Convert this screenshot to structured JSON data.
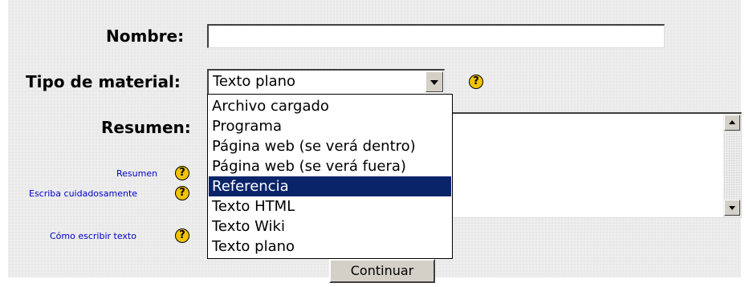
{
  "form": {
    "name_label": "Nombre:",
    "name_value": "",
    "type_label": "Tipo de material:",
    "type_selected": "Texto plano",
    "summary_label": "Resumen:",
    "help_icon_char": "?",
    "continue_label": "Continuar",
    "help_links": [
      "Resumen",
      "Escriba cuidadosamente",
      "Cómo escribir texto"
    ]
  },
  "dropdown": {
    "options": [
      "Archivo cargado",
      "Programa",
      "Página web (se verá dentro)",
      "Página web (se verá fuera)",
      "Referencia",
      "Texto HTML",
      "Texto Wiki",
      "Texto plano"
    ],
    "highlighted_index": 4
  },
  "colors": {
    "highlight": "#0a246a",
    "help_icon": "#f2c300",
    "link": "#0000cc"
  }
}
